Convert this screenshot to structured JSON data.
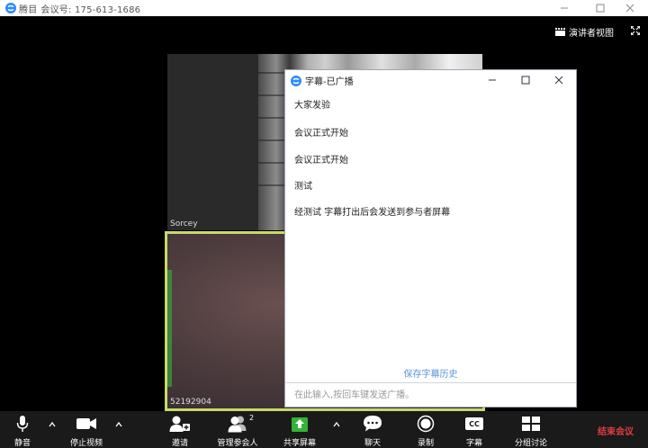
{
  "window": {
    "app_name": "腾目",
    "title": "会议号: 175-613-1686"
  },
  "view": {
    "label": "演讲者视图"
  },
  "tiles": [
    {
      "name": "Sorcey"
    },
    {
      "name": "52192904"
    }
  ],
  "captions": {
    "title": "字幕-已广播",
    "lines": [
      "大家发验",
      "会议正式开始",
      "会议正式开始",
      "测试",
      "经测试 字幕打出后会发送到参与者屏幕"
    ],
    "save_history": "保存字幕历史",
    "input_placeholder": "在此输入,按回车键发送广播。"
  },
  "toolbar": {
    "mute": "静音",
    "stop_video": "停止视频",
    "invite": "邀请",
    "manage_participants": "管理参会人",
    "participant_count": "2",
    "share_screen": "共享屏幕",
    "chat": "聊天",
    "record": "录制",
    "captions": "字幕",
    "captions_icon_text": "CC",
    "breakout": "分组讨论",
    "end_meeting": "结束会议"
  },
  "colors": {
    "accent": "#2d8cff",
    "share_green": "#36b336",
    "end_red": "#e03d3d",
    "active_speaker_border": "#c8d96b",
    "link_blue": "#5a96d8"
  }
}
